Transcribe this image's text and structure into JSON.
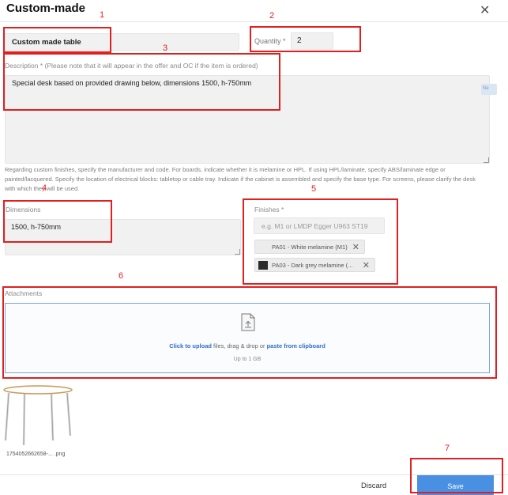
{
  "dialog": {
    "title": "Custom-made",
    "close_glyph": "✕"
  },
  "form": {
    "name_value": "Custom made table",
    "quantity_label": "Quantity *",
    "quantity_value": "2",
    "description_label": "Description * (Please note that it will appear in the offer and OC if the item is ordered)",
    "description_value": "Special desk based on provided drawing below, dimensions 1500, h-750mm",
    "side_tab_text": "Ne",
    "help_text": "Regarding custom finishes, specify the manufacturer and code. For boards, indicate whether it is melamine or HPL. If using HPL/laminate, specify ABS/laminate edge or painted/lacquered. Specify the location of electrical blocks: tabletop or cable tray. Indicate if the cabinet is assembled and specify the base type. For screens, please clarify the desk with which they will be used.",
    "dimensions_label": "Dimensions",
    "dimensions_value": "1500, h-750mm",
    "finishes_label": "Finishes *",
    "finishes_placeholder": "e.g. M1 or LMDP Egger U963 ST19",
    "finishes_chips": [
      {
        "label": "PA01 - White melamine (M1)",
        "swatch": ""
      },
      {
        "label": "PA03 - Dark grey melamine (...",
        "swatch": "#2b2b2b"
      }
    ],
    "chip_remove_glyph": "✕"
  },
  "attachments": {
    "label": "Attachments",
    "upload_link": "Click to upload",
    "mid_text": " files, drag & drop or ",
    "paste_link": "paste from clipboard",
    "limit": "Up to 1 GB",
    "file_name": "1754052662658-... .png",
    "icon": "file-upload-icon"
  },
  "footer": {
    "discard_label": "Discard",
    "save_label": "Save"
  },
  "annotations": {
    "color": "#e02020",
    "numbers": [
      "1",
      "2",
      "3",
      "4",
      "5",
      "6",
      "7"
    ]
  }
}
